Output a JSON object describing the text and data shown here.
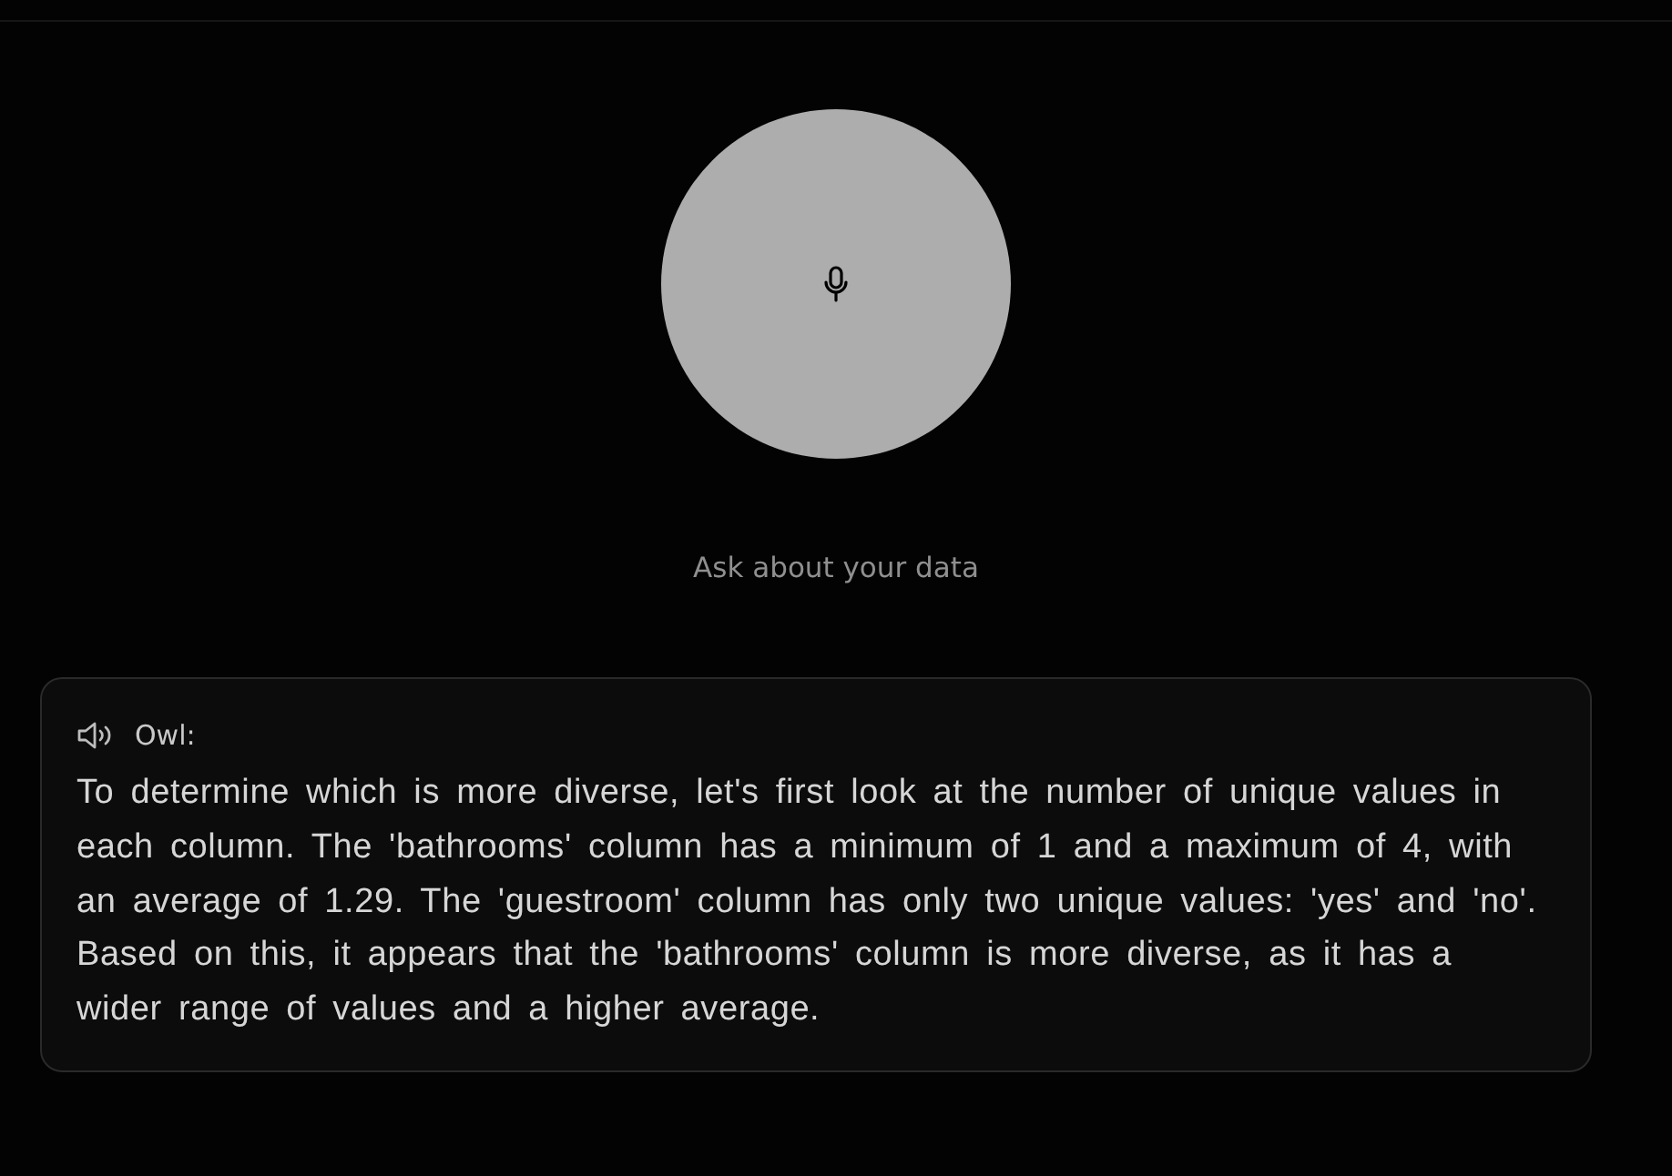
{
  "prompt": "Ask about your data",
  "message": {
    "speaker": "Owl:",
    "text": "To determine which is more diverse, let's first look at the number of unique values in each column. The 'bathrooms' column has a minimum of 1 and a maximum of 4, with an average of 1.29. The 'guestroom' column has only two unique values: 'yes' and 'no'. Based on this, it appears that the 'bathrooms' column is more diverse, as it has a wider range of values and a higher average."
  }
}
